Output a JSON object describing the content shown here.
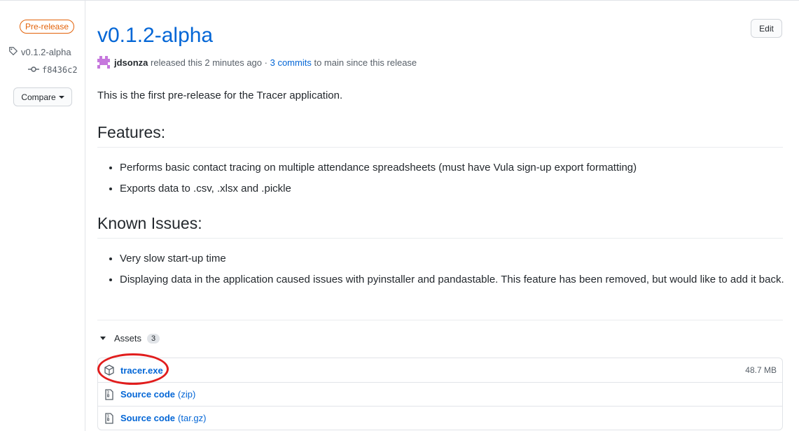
{
  "sidebar": {
    "badge": "Pre-release",
    "tag": "v0.1.2-alpha",
    "commit": "f8436c2",
    "compare_label": "Compare"
  },
  "release": {
    "title": "v0.1.2-alpha",
    "edit_label": "Edit",
    "author": "jdsonza",
    "released_text": "released this 2 minutes ago",
    "separator": "·",
    "commits_link": "3 commits",
    "commits_suffix": "to main since this release"
  },
  "body": {
    "intro": "This is the first pre-release for the Tracer application.",
    "features_heading": "Features:",
    "features": [
      "Performs basic contact tracing on multiple attendance spreadsheets (must have Vula sign-up export formatting)",
      "Exports data to .csv, .xlsx and .pickle"
    ],
    "issues_heading": "Known Issues:",
    "issues": [
      "Very slow start-up time",
      "Displaying data in the application caused issues with pyinstaller and pandastable. This feature has been removed, but would like to add it back."
    ]
  },
  "assets": {
    "label": "Assets",
    "count": "3",
    "items": [
      {
        "name": "tracer.exe",
        "sub": "",
        "size": "48.7 MB",
        "icon": "package-icon"
      },
      {
        "name": "Source code",
        "sub": "(zip)",
        "size": "",
        "icon": "file-zip-icon"
      },
      {
        "name": "Source code",
        "sub": "(tar.gz)",
        "size": "",
        "icon": "file-zip-icon"
      }
    ]
  },
  "colors": {
    "link": "#0366d6",
    "prerelease": "#e36209",
    "annotation": "#e11d1d"
  }
}
